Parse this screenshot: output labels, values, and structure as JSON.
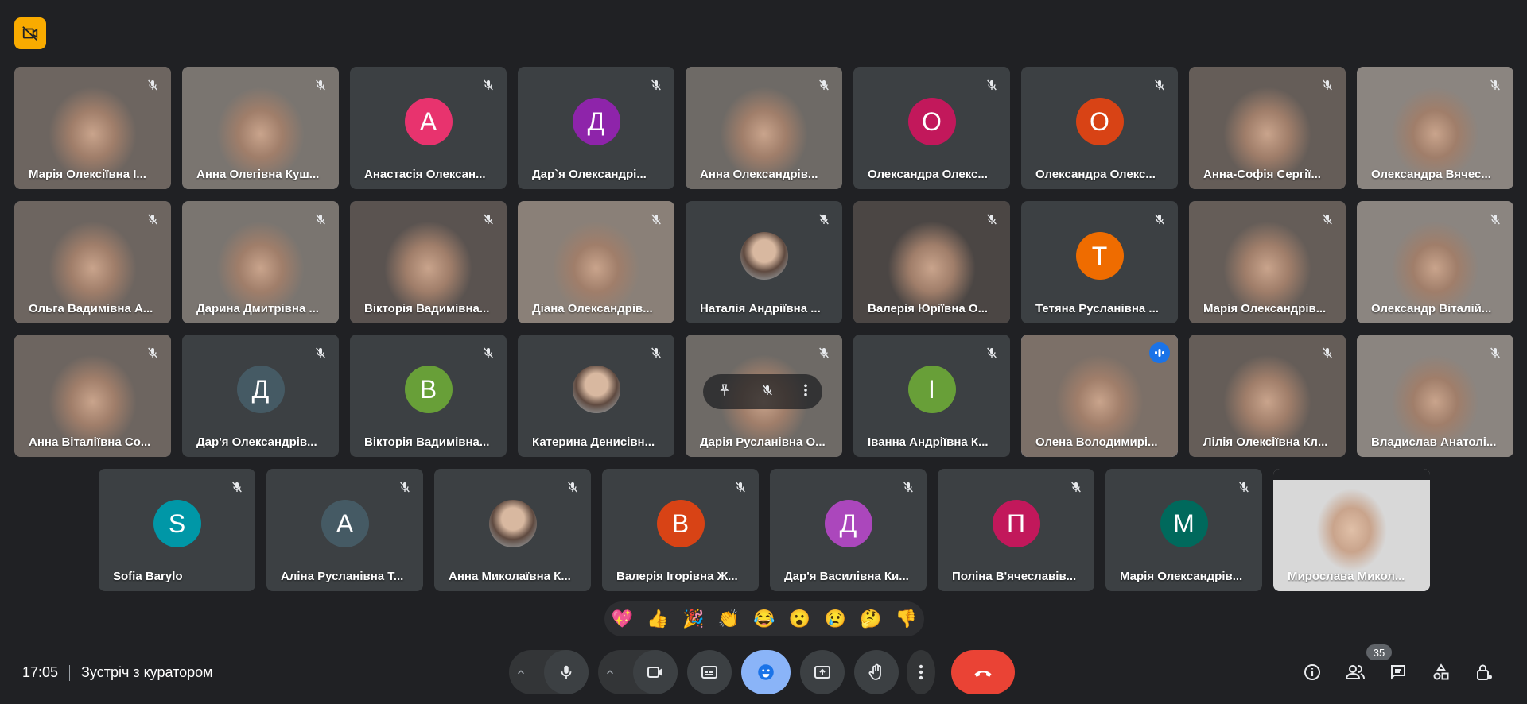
{
  "meeting": {
    "time": "17:05",
    "title": "Зустріч з куратором",
    "participant_count": "35"
  },
  "reactions": [
    "💖",
    "👍",
    "🎉",
    "👏",
    "😂",
    "😮",
    "😢",
    "🤔",
    "👎"
  ],
  "colors": {
    "background": "#202124",
    "tile": "#3c4043",
    "end_call": "#ea4335",
    "reaction_active": "#8ab4f8",
    "record_badge": "#f9ab00"
  },
  "rows": [
    {
      "tiles": [
        {
          "name": "Марія Олексіївна І...",
          "type": "video",
          "muted": true
        },
        {
          "name": "Анна Олегівна Куш...",
          "type": "video",
          "muted": true
        },
        {
          "name": "Анастасія Олексан...",
          "type": "avatar",
          "initial": "А",
          "color": "#e8336e",
          "muted": true
        },
        {
          "name": "Дар`я Олександрі...",
          "type": "avatar",
          "initial": "Д",
          "color": "#8e24aa",
          "muted": true
        },
        {
          "name": "Анна Олександрів...",
          "type": "video",
          "muted": true
        },
        {
          "name": "Олександра Олекс...",
          "type": "avatar",
          "initial": "О",
          "color": "#c2185b",
          "muted": true
        },
        {
          "name": "Олександра Олекс...",
          "type": "avatar",
          "initial": "О",
          "color": "#d84315",
          "muted": true
        },
        {
          "name": "Анна-Софія Сергії...",
          "type": "video",
          "muted": true
        },
        {
          "name": "Олександра Вячес...",
          "type": "video",
          "muted": true
        }
      ]
    },
    {
      "tiles": [
        {
          "name": "Ольга Вадимівна А...",
          "type": "video",
          "muted": true
        },
        {
          "name": "Дарина Дмитрівна ...",
          "type": "video",
          "muted": true
        },
        {
          "name": "Вікторія Вадимівна...",
          "type": "video",
          "muted": true
        },
        {
          "name": "Діана Олександрів...",
          "type": "video",
          "muted": true
        },
        {
          "name": "Наталія Андріївна ...",
          "type": "photo",
          "muted": true
        },
        {
          "name": "Валерія Юріївна О...",
          "type": "video",
          "muted": true
        },
        {
          "name": "Тетяна Русланівна ...",
          "type": "avatar",
          "initial": "Т",
          "color": "#ef6c00",
          "muted": true
        },
        {
          "name": "Марія Олександрів...",
          "type": "video",
          "muted": true
        },
        {
          "name": "Олександр Віталій...",
          "type": "video",
          "muted": true
        }
      ]
    },
    {
      "tiles": [
        {
          "name": "Анна Віталіївна Со...",
          "type": "video",
          "muted": true
        },
        {
          "name": "Дар'я Олександрів...",
          "type": "avatar",
          "initial": "Д",
          "color": "#455a64",
          "muted": true
        },
        {
          "name": "Вікторія Вадимівна...",
          "type": "avatar",
          "initial": "В",
          "color": "#689f38",
          "muted": true
        },
        {
          "name": "Катерина Денисівн...",
          "type": "photo",
          "muted": true
        },
        {
          "name": "Дарія Русланівна О...",
          "type": "video",
          "muted": true,
          "hover": true
        },
        {
          "name": "Іванна Андріївна К...",
          "type": "avatar",
          "initial": "І",
          "color": "#689f38",
          "muted": true
        },
        {
          "name": "Олена Володимирі...",
          "type": "video",
          "muted": false,
          "speaking": true
        },
        {
          "name": "Лілія Олексіївна Кл...",
          "type": "video",
          "muted": true
        },
        {
          "name": "Владислав Анатолі...",
          "type": "video",
          "muted": true
        }
      ]
    },
    {
      "tiles": [
        {
          "name": "Sofia Barylo",
          "type": "avatar",
          "initial": "S",
          "color": "#0097a7",
          "muted": true
        },
        {
          "name": "Аліна Русланівна Т...",
          "type": "avatar",
          "initial": "А",
          "color": "#455a64",
          "muted": true
        },
        {
          "name": "Анна Миколаївна К...",
          "type": "photo",
          "muted": true
        },
        {
          "name": "Валерія Ігорівна Ж...",
          "type": "avatar",
          "initial": "В",
          "color": "#d84315",
          "muted": true
        },
        {
          "name": "Дар'я Василівна Ки...",
          "type": "avatar",
          "initial": "Д",
          "color": "#ab47bc",
          "muted": true
        },
        {
          "name": "Поліна В'ячеславів...",
          "type": "avatar",
          "initial": "П",
          "color": "#c2185b",
          "muted": true
        },
        {
          "name": "Марія Олександрів...",
          "type": "avatar",
          "initial": "М",
          "color": "#00695c",
          "muted": true
        },
        {
          "name": "Мирослава Микол...",
          "type": "video",
          "muted": false,
          "self": true
        }
      ]
    }
  ]
}
